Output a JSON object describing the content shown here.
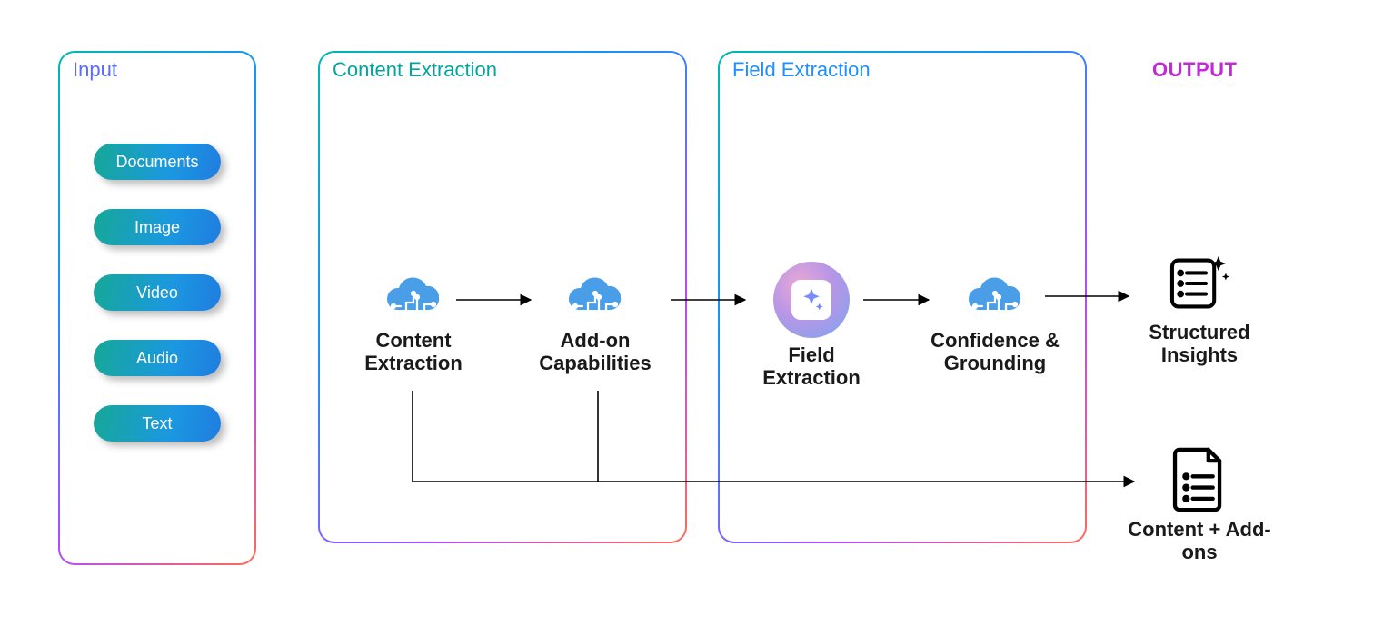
{
  "panels": {
    "input": {
      "title": "Input",
      "items": [
        "Documents",
        "Image",
        "Video",
        "Audio",
        "Text"
      ]
    },
    "content": {
      "title": "Content Extraction",
      "nodes": {
        "content_extraction": "Content Extraction",
        "addon": "Add-on Capabilities"
      }
    },
    "field": {
      "title": "Field Extraction",
      "nodes": {
        "field_extraction": "Field Extraction",
        "confidence": "Confidence & Grounding"
      }
    }
  },
  "output": {
    "label": "OUTPUT",
    "structured": "Structured Insights",
    "content_addons": "Content + Add-ons"
  }
}
